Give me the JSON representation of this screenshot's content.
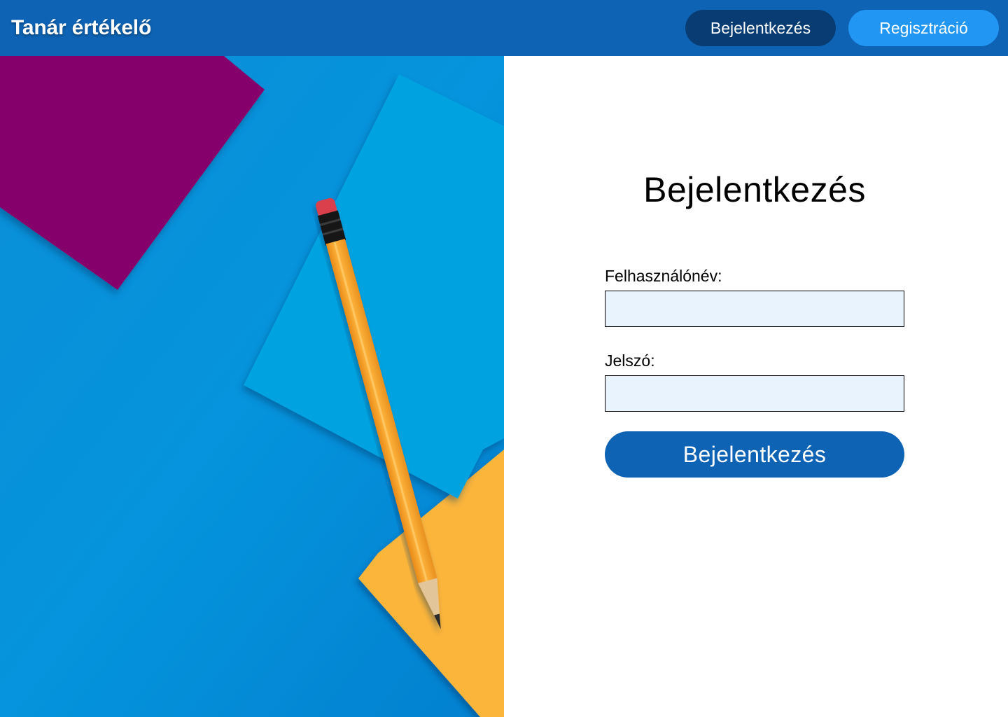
{
  "colors": {
    "navbar": "#0e63b4",
    "nav_login_button": "#083c72",
    "nav_register_button": "#2196f3",
    "input_background": "#e8f3fd",
    "submit_button": "#0e63b4",
    "hero_background": "#0591dc",
    "paper_purple": "#85066a",
    "paper_light_blue": "#05a3e0",
    "paper_yellow": "#fbb53b",
    "pencil_body": "#f8a22b"
  },
  "header": {
    "brand": "Tanár értékelő",
    "login_label": "Bejelentkezés",
    "register_label": "Regisztráció"
  },
  "hero": {
    "image": "pencil-on-colored-paper"
  },
  "login_form": {
    "title": "Bejelentkezés",
    "username_label": "Felhasználónév:",
    "username_value": "",
    "password_label": "Jelszó:",
    "password_value": "",
    "submit_label": "Bejelentkezés"
  }
}
